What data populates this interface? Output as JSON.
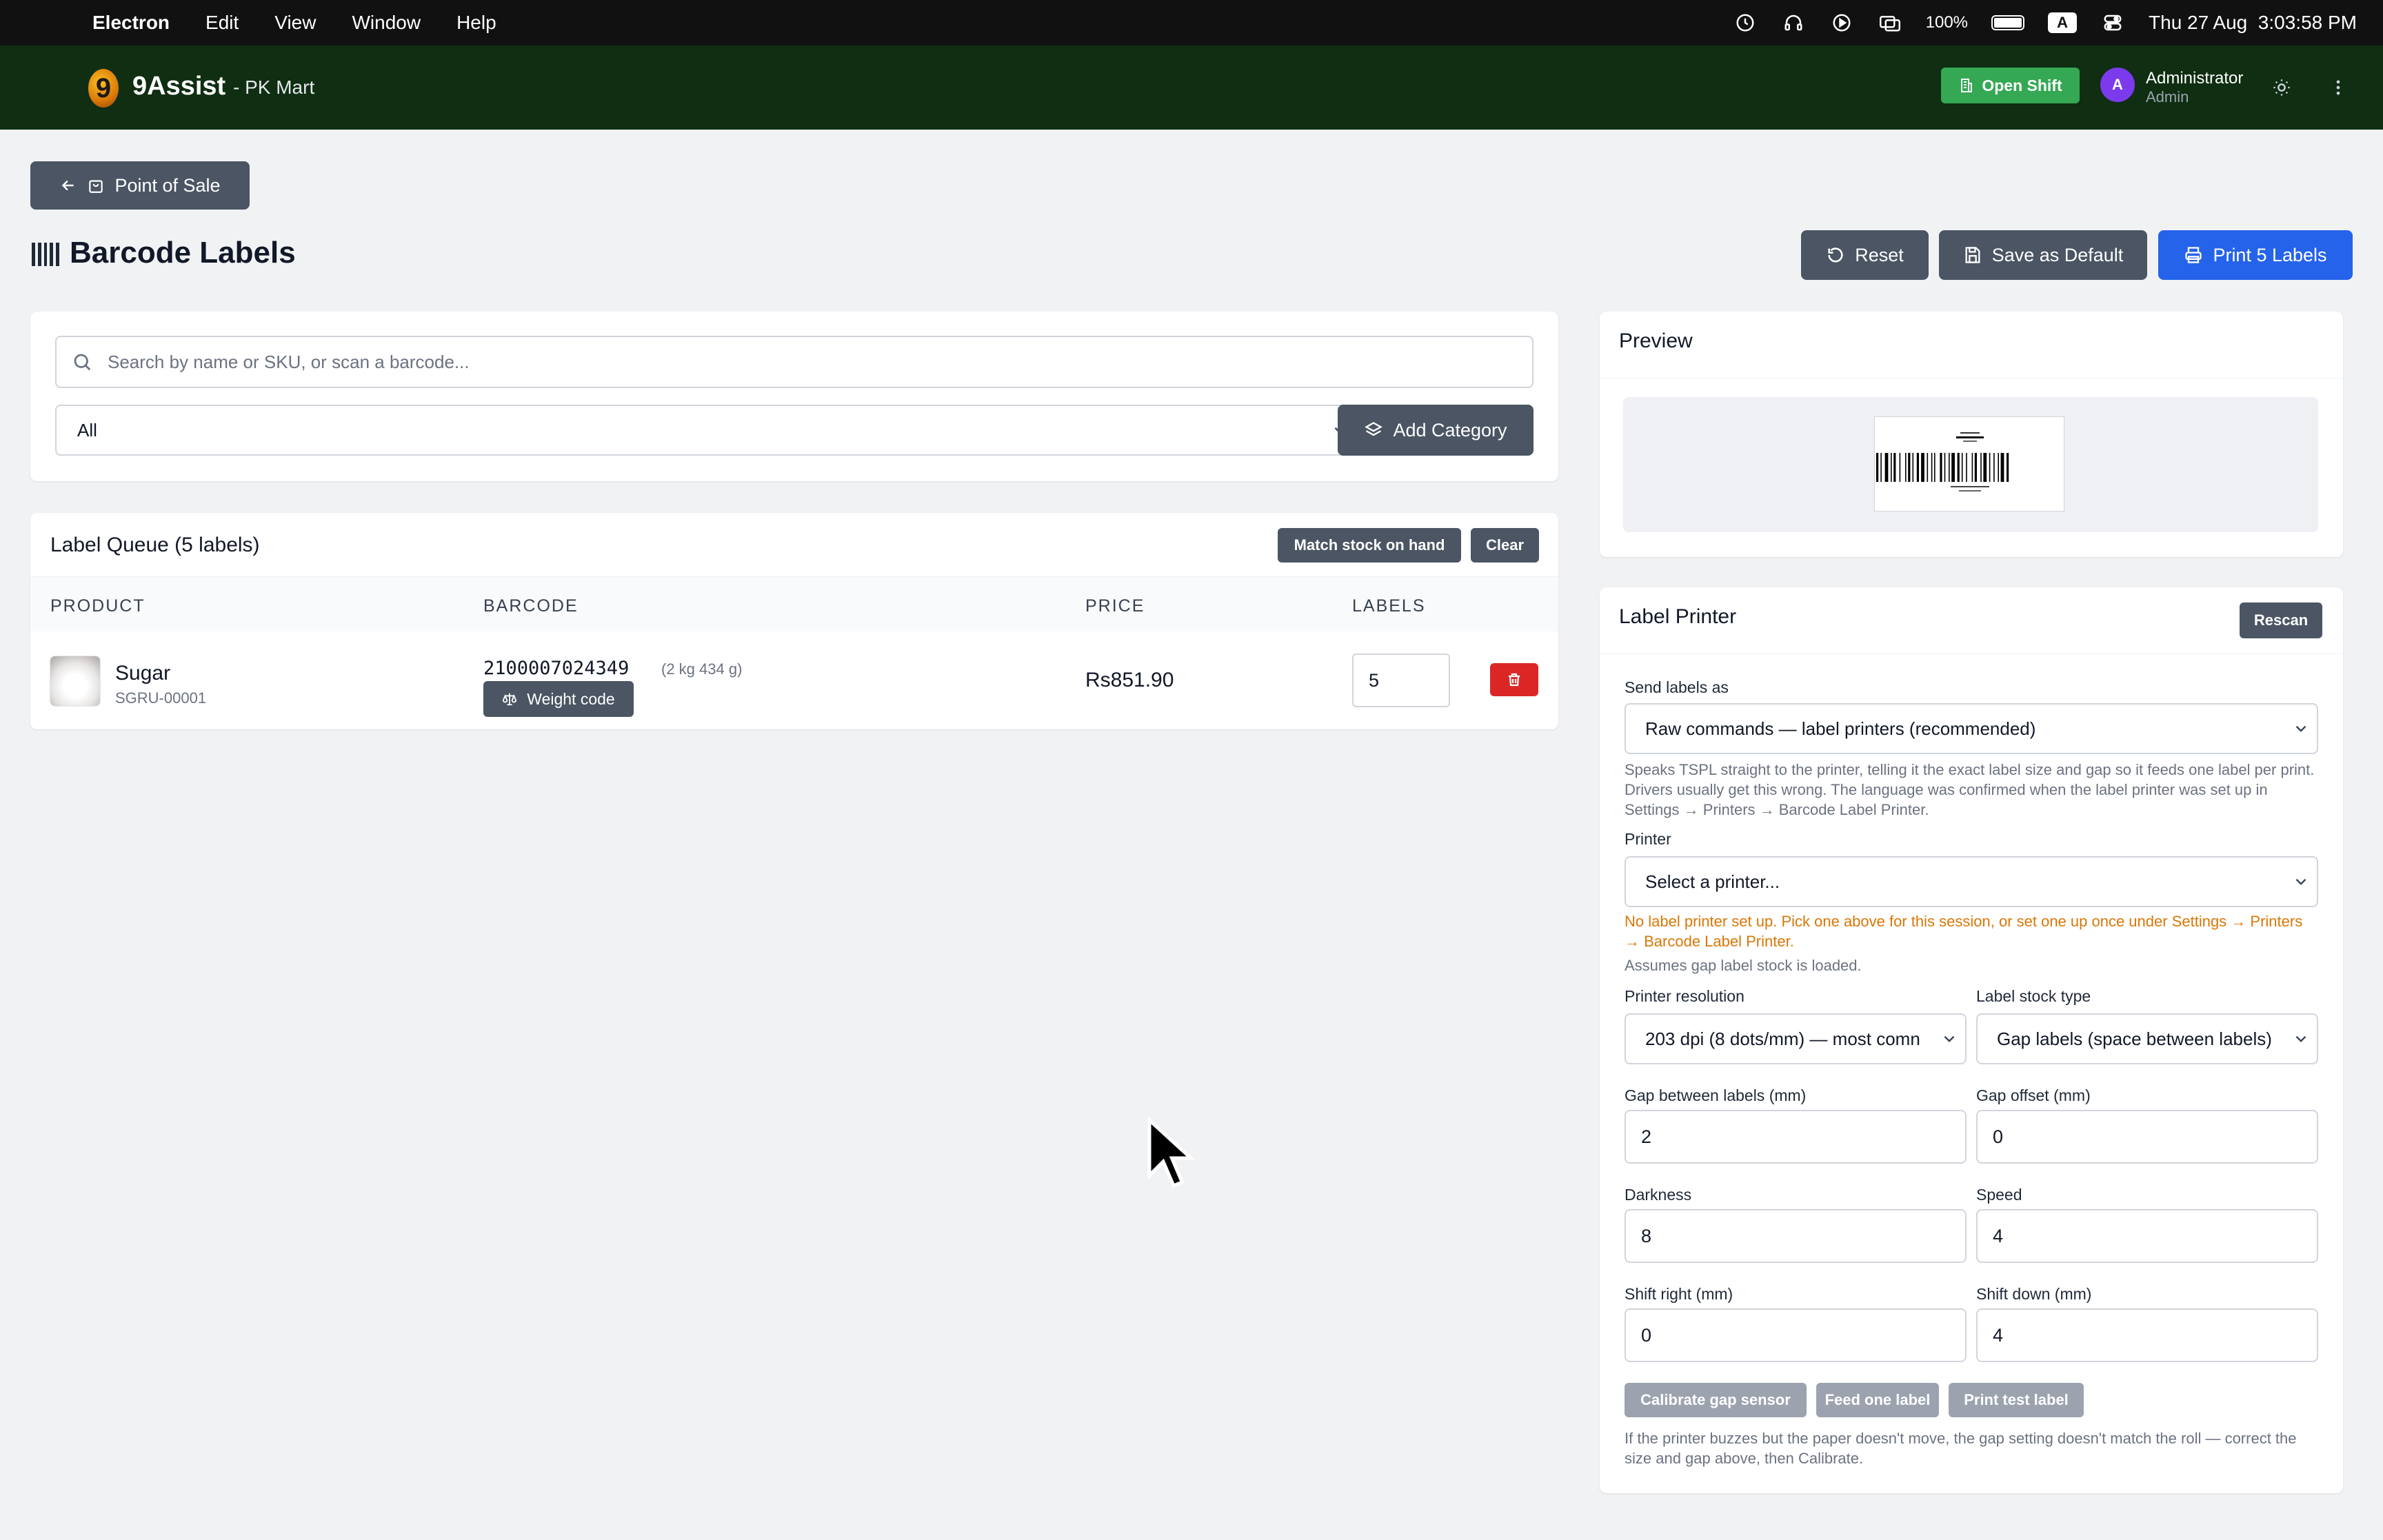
{
  "menubar": {
    "app": "Electron",
    "items": [
      "Edit",
      "View",
      "Window",
      "Help"
    ],
    "battery": "100%",
    "input_source": "A",
    "datetime": "Thu 27 Aug  3:03:58 PM"
  },
  "header": {
    "logo_glyph": "9",
    "brand": "9Assist",
    "store": "- PK Mart",
    "open_shift": "Open Shift",
    "avatar_initial": "A",
    "user_name": "Administrator",
    "user_role": "Admin"
  },
  "toolbar": {
    "back_label": "Point of Sale",
    "title": "Barcode Labels",
    "reset": "Reset",
    "save_default": "Save as Default",
    "print": "Print 5 Labels"
  },
  "search": {
    "placeholder": "Search by name or SKU, or scan a barcode...",
    "category_value": "All",
    "add_category": "Add Category"
  },
  "queue": {
    "title": "Label Queue (5 labels)",
    "match_stock": "Match stock on hand",
    "clear": "Clear",
    "columns": [
      "PRODUCT",
      "BARCODE",
      "PRICE",
      "LABELS"
    ],
    "rows": [
      {
        "name": "Sugar",
        "sku": "SGRU-00001",
        "barcode": "2100007024349",
        "weight": "(2 kg 434 g)",
        "tag": "Weight code",
        "price": "Rs851.90",
        "labels": "5"
      }
    ]
  },
  "preview": {
    "title": "Preview"
  },
  "printer": {
    "title": "Label Printer",
    "rescan": "Rescan",
    "send_as_label": "Send labels as",
    "send_as_value": "Raw commands — label printers (recommended)",
    "send_as_help": "Speaks TSPL straight to the printer, telling it the exact label size and gap so it feeds one label per print. Drivers usually get this wrong. The language was confirmed when the label printer was set up in Settings → Printers → Barcode Label Printer.",
    "printer_label": "Printer",
    "printer_value": "Select a printer...",
    "printer_warning": "No label printer set up. Pick one above for this session, or set one up once under Settings → Printers → Barcode Label Printer.",
    "gap_note": "Assumes gap label stock is loaded.",
    "resolution_label": "Printer resolution",
    "resolution_value": "203 dpi (8 dots/mm) — most comn",
    "stock_label": "Label stock type",
    "stock_value": "Gap labels (space between labels)",
    "gap_label": "Gap between labels (mm)",
    "gap_value": "2",
    "gap_offset_label": "Gap offset (mm)",
    "gap_offset_value": "0",
    "darkness_label": "Darkness",
    "darkness_value": "8",
    "speed_label": "Speed",
    "speed_value": "4",
    "shift_right_label": "Shift right (mm)",
    "shift_right_value": "0",
    "shift_down_label": "Shift down (mm)",
    "shift_down_value": "4",
    "calibrate": "Calibrate gap sensor",
    "feed": "Feed one label",
    "test": "Print test label",
    "footer_help": "If the printer buzzes but the paper doesn't move, the gap setting doesn't match the roll — correct the size and gap above, then Calibrate."
  },
  "colors": {
    "header_bg": "#0f2e12",
    "open_shift": "#34a853",
    "primary": "#2563eb",
    "danger": "#dc2626",
    "warning": "#d97706"
  }
}
